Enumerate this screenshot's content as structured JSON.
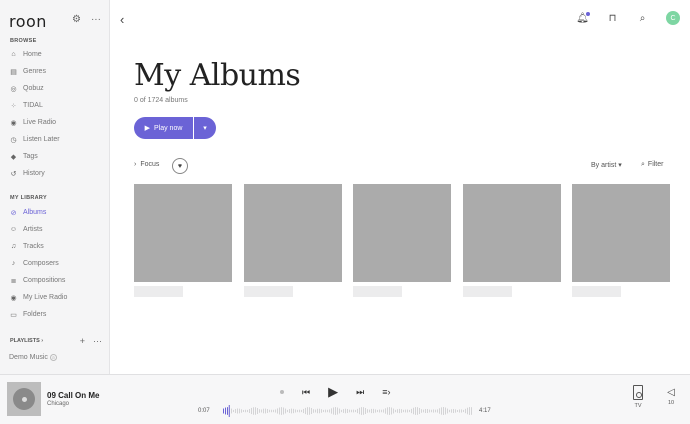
{
  "colors": {
    "accent": "#6b63d6",
    "avatar": "#7ed6a3",
    "placeholder_art": "#ababab"
  },
  "sidebar": {
    "logo": "roon",
    "browse_label": "BROWSE",
    "browse_items": [
      {
        "label": "Home",
        "icon": "home-icon"
      },
      {
        "label": "Genres",
        "icon": "genres-icon"
      },
      {
        "label": "Qobuz",
        "icon": "qobuz-icon"
      },
      {
        "label": "TIDAL",
        "icon": "tidal-icon"
      },
      {
        "label": "Live Radio",
        "icon": "radio-icon"
      },
      {
        "label": "Listen Later",
        "icon": "listen-later-icon"
      },
      {
        "label": "Tags",
        "icon": "tag-icon"
      },
      {
        "label": "History",
        "icon": "history-icon"
      }
    ],
    "library_label": "MY LIBRARY",
    "library_items": [
      {
        "label": "Albums",
        "icon": "album-icon",
        "active": true
      },
      {
        "label": "Artists",
        "icon": "artist-icon"
      },
      {
        "label": "Tracks",
        "icon": "tracks-icon"
      },
      {
        "label": "Composers",
        "icon": "composer-icon"
      },
      {
        "label": "Compositions",
        "icon": "compositions-icon"
      },
      {
        "label": "My Live Radio",
        "icon": "radio-icon"
      },
      {
        "label": "Folders",
        "icon": "folder-icon"
      }
    ],
    "playlists_label": "PLAYLISTS",
    "demo_playlist": "Demo Music"
  },
  "main": {
    "title": "My Albums",
    "subtitle": "0 of 1724 albums",
    "play_label": "Play now",
    "focus_label": "Focus",
    "sort_label": "By artist",
    "filter_label": "Filter",
    "avatar_letter": "C",
    "album_count_visible": 5
  },
  "player": {
    "track": "09 Call On Me",
    "artist": "Chicago",
    "elapsed": "0:07",
    "duration": "4:17",
    "progress": 0.027,
    "zone": "TV",
    "volume": "10"
  }
}
